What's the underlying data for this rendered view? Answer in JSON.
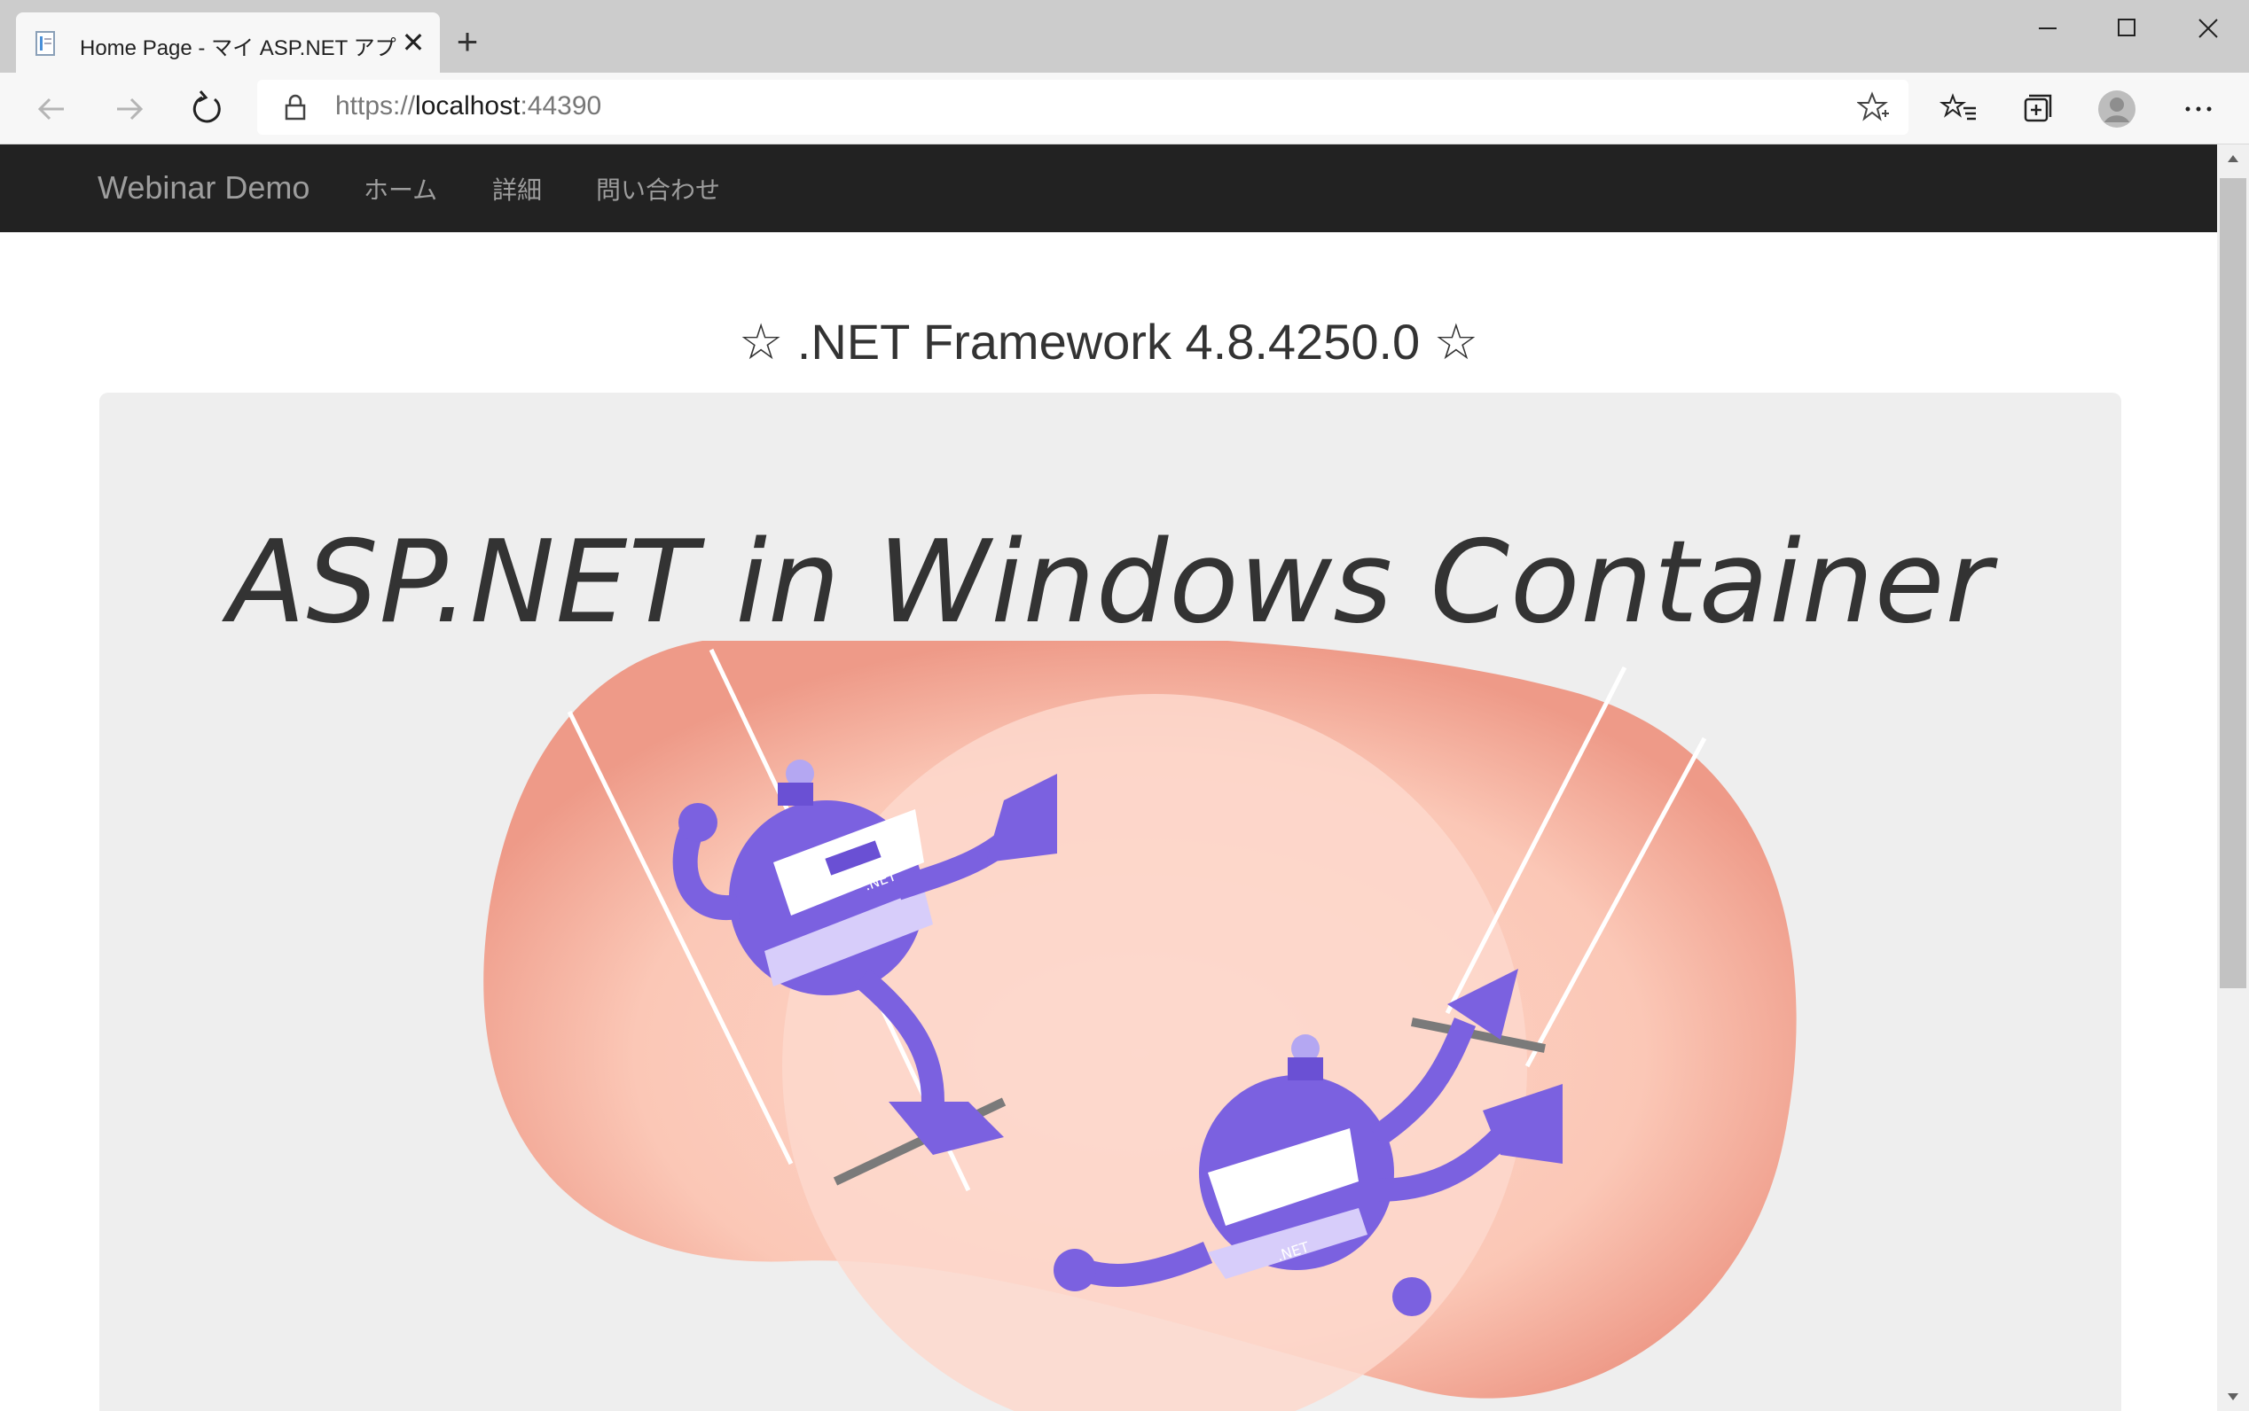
{
  "browser": {
    "tab": {
      "title": "Home Page - マイ ASP.NET アプリケーション",
      "close_label": "✕"
    },
    "new_tab_label": "+",
    "address": {
      "scheme": "https://",
      "host": "localhost",
      "port": ":44390"
    }
  },
  "app": {
    "brand": "Webinar Demo",
    "nav": {
      "home": "ホーム",
      "about": "詳細",
      "contact": "問い合わせ"
    }
  },
  "main": {
    "heading": "☆ .NET Framework 4.8.4250.0 ☆",
    "jumbotron_title": "ASP.NET in Windows Container",
    "illustration": {
      "badge_text": ".NET",
      "accent_color": "#7b61e0",
      "blob_color": "#ee9a88",
      "glow_color": "#fdd8cc"
    }
  }
}
